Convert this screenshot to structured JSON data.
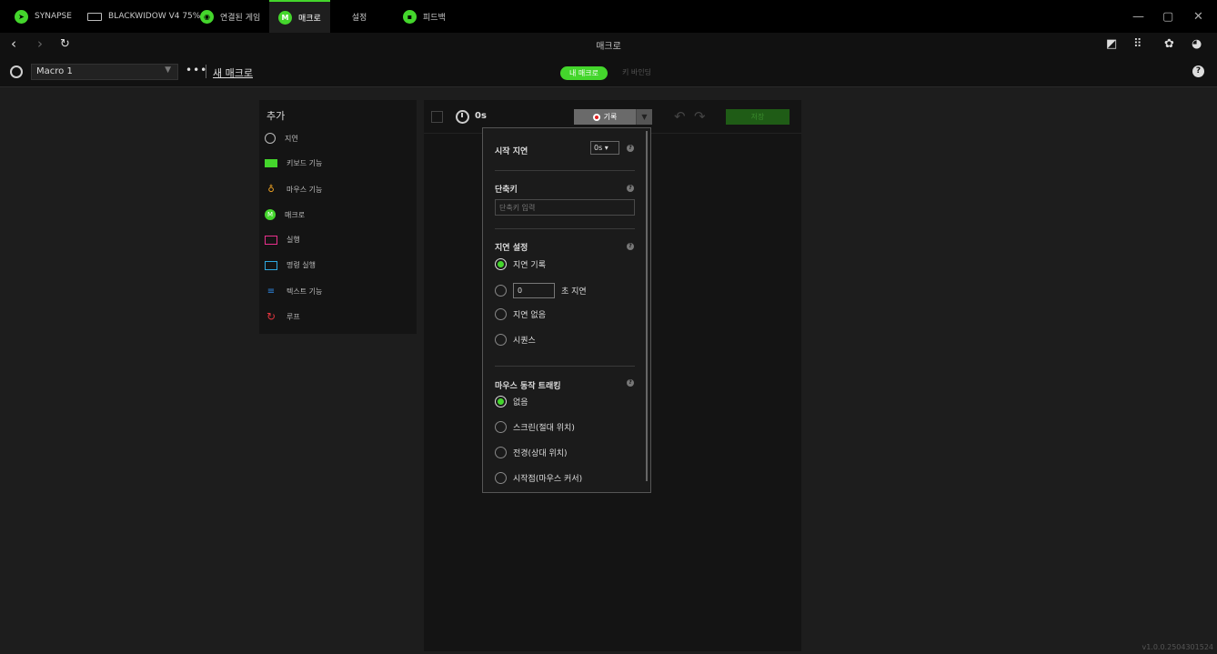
{
  "tabs": [
    {
      "label": "SYNAPSE",
      "icon": "synapse-icon"
    },
    {
      "label": "BLACKWIDOW V4 75%",
      "icon": "keyboard-icon"
    },
    {
      "label": "연결된 게임",
      "icon": "gamepad-icon"
    },
    {
      "label": "매크로",
      "icon": "macro-icon"
    },
    {
      "label": "설정",
      "icon": "gear-icon"
    },
    {
      "label": "피드백",
      "icon": "feedback-icon"
    }
  ],
  "nav": {
    "title": "매크로"
  },
  "toolbar": {
    "macro_name": "Macro 1",
    "new_macro": "새 매크로",
    "segment_active": "내 매크로",
    "segment_inactive": "키 바인딩"
  },
  "add_panel": {
    "title": "추가",
    "items": [
      {
        "label": "지연",
        "icon": "clock-icon"
      },
      {
        "label": "키보드 기능",
        "icon": "keyboard-icon"
      },
      {
        "label": "마우스 기능",
        "icon": "mouse-icon"
      },
      {
        "label": "매크로",
        "icon": "macro-icon"
      },
      {
        "label": "실행",
        "icon": "launch-icon"
      },
      {
        "label": "명령 실행",
        "icon": "command-icon"
      },
      {
        "label": "텍스트 기능",
        "icon": "text-icon"
      },
      {
        "label": "루프",
        "icon": "loop-icon"
      }
    ]
  },
  "editor": {
    "duration": "0s",
    "record_label": "기록",
    "save_label": "저장"
  },
  "dropdown": {
    "start_delay_label": "시작 지연",
    "start_delay_value": "0s ▾",
    "hotkey_label": "단축키",
    "hotkey_placeholder": "단축키 입력",
    "delay_settings_label": "지연 설정",
    "delay_options": [
      "지연 기록",
      "초 지연",
      "지연 없음",
      "시퀀스"
    ],
    "delay_seconds_value": "0",
    "delay_selected": "지연 기록",
    "mouse_tracking_label": "마우스 동작 트래킹",
    "mouse_options": [
      "없음",
      "스크린(절대 위치)",
      "전경(상대 위치)",
      "시작점(마우스 커서)"
    ],
    "mouse_selected": "없음"
  },
  "version": "v1.0.0.2504301524",
  "colors": {
    "accent": "#44d62c",
    "record": "#e12222",
    "background": "#1d1d1d"
  }
}
